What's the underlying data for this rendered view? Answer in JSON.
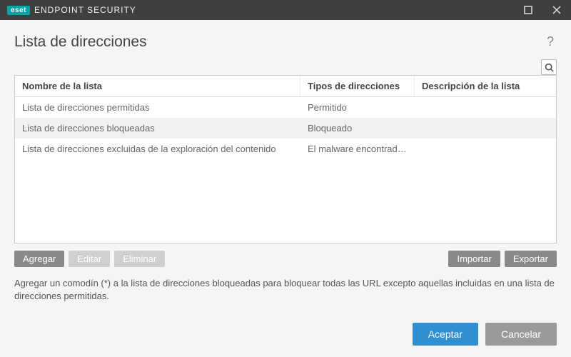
{
  "titlebar": {
    "brand": "eset",
    "product": "ENDPOINT SECURITY"
  },
  "page": {
    "title": "Lista de direcciones",
    "help_tooltip": "?"
  },
  "table": {
    "columns": {
      "name": "Nombre de la lista",
      "type": "Tipos de direcciones",
      "desc": "Descripción de la lista"
    },
    "rows": [
      {
        "name": "Lista de direcciones permitidas",
        "type": "Permitido",
        "desc": ""
      },
      {
        "name": "Lista de direcciones bloqueadas",
        "type": "Bloqueado",
        "desc": ""
      },
      {
        "name": "Lista de direcciones excluidas de la exploración del contenido",
        "type": "El malware encontrado se...",
        "desc": ""
      }
    ]
  },
  "buttons": {
    "add": "Agregar",
    "edit": "Editar",
    "delete": "Eliminar",
    "import": "Importar",
    "export": "Exportar"
  },
  "hint": "Agregar un comodín (*) a la lista de direcciones bloqueadas para bloquear todas las URL excepto aquellas incluidas en una lista de direcciones permitidas.",
  "footer": {
    "accept": "Aceptar",
    "cancel": "Cancelar"
  }
}
